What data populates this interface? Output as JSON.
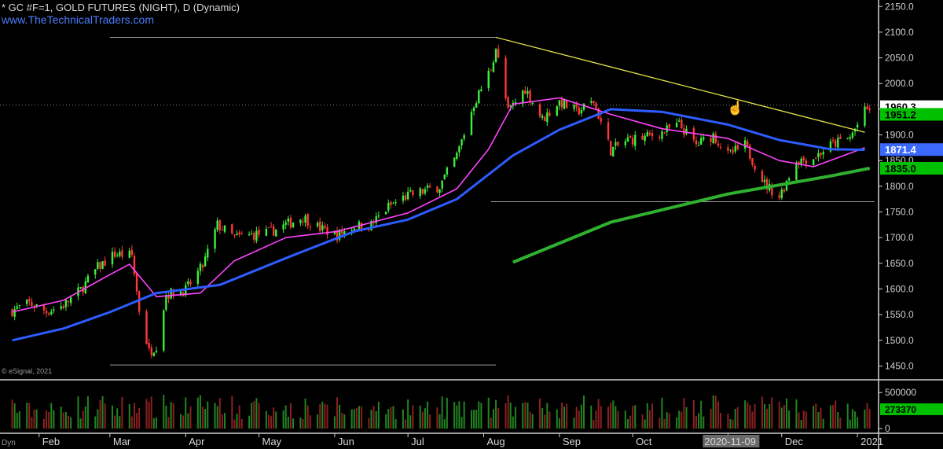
{
  "header": {
    "title": "* GC #F=1, GOLD FUTURES (NIGHT), D (Dynamic)",
    "url": "www.TheTechnicalTraders.com"
  },
  "copyright": "© eSignal, 2021",
  "corner_label": "Dyn",
  "cursor_icon": "hand-pointer-icon",
  "chart_data": [
    {
      "type": "candlestick",
      "title": "* GC #F=1, GOLD FUTURES (NIGHT), D (Dynamic)",
      "ylim": [
        1440,
        2155
      ],
      "y_ticks": [
        "2150.0",
        "2100.0",
        "2050.0",
        "2000.0",
        "1950.0",
        "1900.0",
        "1850.0",
        "1800.0",
        "1750.0",
        "1700.0",
        "1650.0",
        "1600.0",
        "1550.0",
        "1500.0",
        "1450.0"
      ],
      "y_tick_values": [
        2150,
        2100,
        2050,
        2000,
        1950,
        1900,
        1850,
        1800,
        1750,
        1700,
        1650,
        1600,
        1550,
        1500,
        1450
      ],
      "x_ticks": [
        "Feb",
        "Mar",
        "Apr",
        "May",
        "Jun",
        "Jul",
        "Aug",
        "Sep",
        "Oct",
        "2020-11-09",
        "Dec",
        "2021"
      ],
      "x_tick_dates": [
        "2020-02-01",
        "2020-03-01",
        "2020-04-01",
        "2020-05-01",
        "2020-06-01",
        "2020-07-01",
        "2020-08-01",
        "2020-09-01",
        "2020-10-01",
        "2020-11-09",
        "2020-12-01",
        "2021-01-01"
      ],
      "highlighted_tick": "2020-11-09",
      "closes": [
        [
          "2020-01-21",
          1558
        ],
        [
          "2020-01-28",
          1572
        ],
        [
          "2020-02-04",
          1556
        ],
        [
          "2020-02-11",
          1568
        ],
        [
          "2020-02-18",
          1598
        ],
        [
          "2020-02-25",
          1642
        ],
        [
          "2020-03-03",
          1668
        ],
        [
          "2020-03-10",
          1665
        ],
        [
          "2020-03-13",
          1560
        ],
        [
          "2020-03-17",
          1478
        ],
        [
          "2020-03-20",
          1490
        ],
        [
          "2020-03-24",
          1590
        ],
        [
          "2020-04-01",
          1598
        ],
        [
          "2020-04-08",
          1645
        ],
        [
          "2020-04-14",
          1725
        ],
        [
          "2020-04-21",
          1700
        ],
        [
          "2020-04-28",
          1705
        ],
        [
          "2020-05-05",
          1710
        ],
        [
          "2020-05-12",
          1725
        ],
        [
          "2020-05-19",
          1740
        ],
        [
          "2020-05-26",
          1718
        ],
        [
          "2020-06-02",
          1705
        ],
        [
          "2020-06-09",
          1722
        ],
        [
          "2020-06-16",
          1725
        ],
        [
          "2020-06-23",
          1760
        ],
        [
          "2020-06-30",
          1780
        ],
        [
          "2020-07-07",
          1790
        ],
        [
          "2020-07-14",
          1800
        ],
        [
          "2020-07-21",
          1860
        ],
        [
          "2020-07-28",
          1960
        ],
        [
          "2020-08-04",
          2030
        ],
        [
          "2020-08-06",
          2070
        ],
        [
          "2020-08-11",
          1945
        ],
        [
          "2020-08-18",
          1990
        ],
        [
          "2020-08-25",
          1930
        ],
        [
          "2020-09-01",
          1965
        ],
        [
          "2020-09-08",
          1945
        ],
        [
          "2020-09-15",
          1965
        ],
        [
          "2020-09-22",
          1870
        ],
        [
          "2020-09-29",
          1890
        ],
        [
          "2020-10-06",
          1895
        ],
        [
          "2020-10-13",
          1905
        ],
        [
          "2020-10-20",
          1920
        ],
        [
          "2020-10-27",
          1880
        ],
        [
          "2020-11-03",
          1900
        ],
        [
          "2020-11-09",
          1860
        ],
        [
          "2020-11-16",
          1880
        ],
        [
          "2020-11-24",
          1805
        ],
        [
          "2020-11-30",
          1780
        ],
        [
          "2020-12-07",
          1850
        ],
        [
          "2020-12-14",
          1855
        ],
        [
          "2020-12-21",
          1880
        ],
        [
          "2020-12-29",
          1895
        ],
        [
          "2021-01-04",
          1945
        ],
        [
          "2021-01-06",
          1951
        ]
      ],
      "series": [
        {
          "name": "",
          "type": "line",
          "color": "#ff44ff",
          "points": [
            [
              "2020-01-21",
              1555
            ],
            [
              "2020-02-11",
              1578
            ],
            [
              "2020-03-01",
              1628
            ],
            [
              "2020-03-09",
              1648
            ],
            [
              "2020-03-20",
              1585
            ],
            [
              "2020-04-07",
              1592
            ],
            [
              "2020-04-21",
              1655
            ],
            [
              "2020-05-12",
              1700
            ],
            [
              "2020-06-02",
              1712
            ],
            [
              "2020-07-01",
              1748
            ],
            [
              "2020-07-21",
              1795
            ],
            [
              "2020-08-03",
              1872
            ],
            [
              "2020-08-13",
              1960
            ],
            [
              "2020-09-01",
              1972
            ],
            [
              "2020-09-22",
              1940
            ],
            [
              "2020-10-13",
              1912
            ],
            [
              "2020-11-09",
              1893
            ],
            [
              "2020-11-30",
              1850
            ],
            [
              "2020-12-14",
              1838
            ],
            [
              "2021-01-04",
              1875
            ]
          ]
        },
        {
          "name": "",
          "type": "line",
          "color": "#2d5cff",
          "points": [
            [
              "2020-01-21",
              1500
            ],
            [
              "2020-02-11",
              1523
            ],
            [
              "2020-03-01",
              1555
            ],
            [
              "2020-03-20",
              1592
            ],
            [
              "2020-04-15",
              1608
            ],
            [
              "2020-05-12",
              1660
            ],
            [
              "2020-06-09",
              1712
            ],
            [
              "2020-07-01",
              1735
            ],
            [
              "2020-07-21",
              1775
            ],
            [
              "2020-08-13",
              1860
            ],
            [
              "2020-09-01",
              1910
            ],
            [
              "2020-09-22",
              1950
            ],
            [
              "2020-10-13",
              1945
            ],
            [
              "2020-11-09",
              1920
            ],
            [
              "2020-11-30",
              1890
            ],
            [
              "2020-12-21",
              1872
            ],
            [
              "2021-01-04",
              1871
            ]
          ]
        },
        {
          "name": "",
          "type": "line",
          "color": "#2fb02f",
          "points": [
            [
              "2020-08-13",
              1652
            ],
            [
              "2020-09-22",
              1730
            ],
            [
              "2020-11-09",
              1785
            ],
            [
              "2020-12-21",
              1820
            ],
            [
              "2021-01-06",
              1835
            ]
          ]
        },
        {
          "name": "",
          "type": "trendline",
          "color": "#e6e64a",
          "points": [
            [
              "2020-08-06",
              2090
            ],
            [
              "2021-01-04",
              1905
            ]
          ]
        },
        {
          "name": "",
          "type": "hline",
          "color": "#9a9a9a",
          "value": 2090,
          "from": "2020-03-01",
          "to": "2020-08-06"
        },
        {
          "name": "",
          "type": "hline",
          "color": "#9a9a9a",
          "value": 1452,
          "from": "2020-03-01",
          "to": "2020-08-06"
        },
        {
          "name": "",
          "type": "hline",
          "color": "#9a9a9a",
          "value": 1770,
          "from": "2020-08-04",
          "to": "2021-01-08"
        }
      ],
      "price_tags": [
        {
          "label": "1960.3",
          "value": 1955,
          "bg": "#ffffff",
          "fg": "#000000"
        },
        {
          "label": "1951.2",
          "value": 1940,
          "bg": "#00c000",
          "fg": "#000000"
        },
        {
          "label": "1871.4",
          "value": 1871.4,
          "bg": "#3b68ff",
          "fg": "#ffffff"
        },
        {
          "label": "1835.0",
          "value": 1835,
          "bg": "#00c000",
          "fg": "#000000"
        }
      ]
    },
    {
      "type": "bar",
      "title": "",
      "ylim": [
        0,
        600000
      ],
      "y_ticks": [
        "500000",
        "0"
      ],
      "y_tick_values": [
        500000,
        0
      ],
      "last_value_label": "273370",
      "last_value": 273370
    }
  ]
}
